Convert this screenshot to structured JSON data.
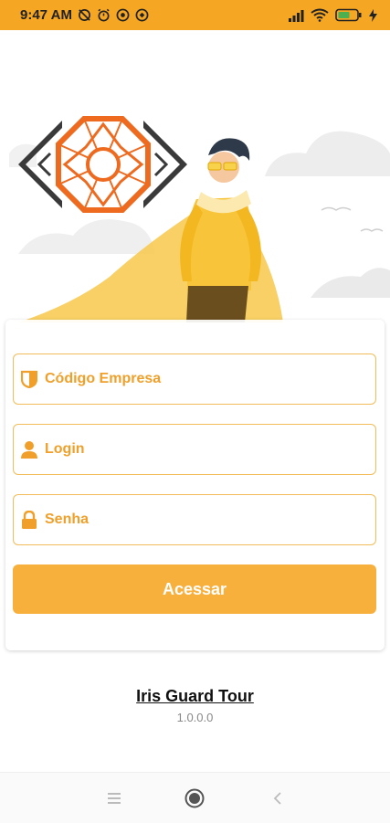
{
  "status_bar": {
    "time": "9:47 AM",
    "battery_level": "partial",
    "colors": {
      "background": "#F5A623"
    }
  },
  "form": {
    "company_placeholder": "Código Empresa",
    "login_placeholder": "Login",
    "password_placeholder": "Senha",
    "submit_label": "Acessar"
  },
  "footer": {
    "app_name": "Iris Guard Tour",
    "version": "1.0.0.0"
  },
  "icons": {
    "company": "shield-icon",
    "login": "user-icon",
    "password": "lock-icon"
  },
  "colors": {
    "accent": "#F8B03D",
    "accent_text": "#F0A02A",
    "logo_orange": "#EE6A1F",
    "logo_dark": "#3A3A3A"
  }
}
